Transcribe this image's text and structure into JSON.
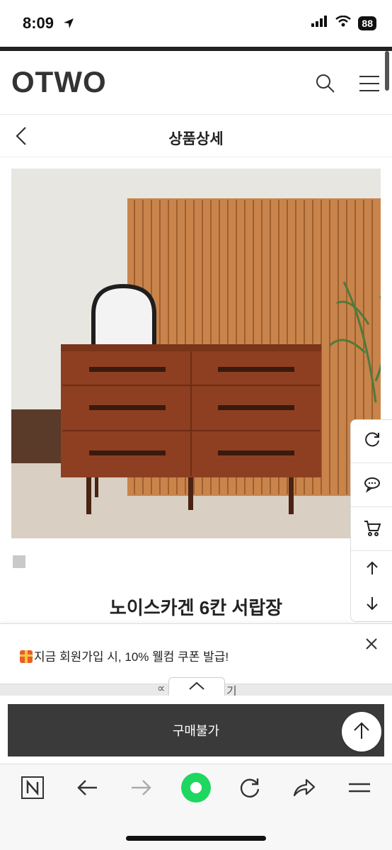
{
  "status": {
    "time": "8:09",
    "battery": "88"
  },
  "header": {
    "logo": "OTWO"
  },
  "page": {
    "title": "상품상세"
  },
  "product": {
    "name": "노이스카겐 6칸 서랍장"
  },
  "coupon": {
    "text": "지금 회원가입 시, 10% 웰컴 쿠폰 발급!"
  },
  "behind": {
    "left": "∝",
    "right": "기"
  },
  "buy": {
    "label": "구매불가"
  },
  "colors": {
    "buy_button": "#3a3a3a",
    "browser_home": "#1ed760"
  }
}
